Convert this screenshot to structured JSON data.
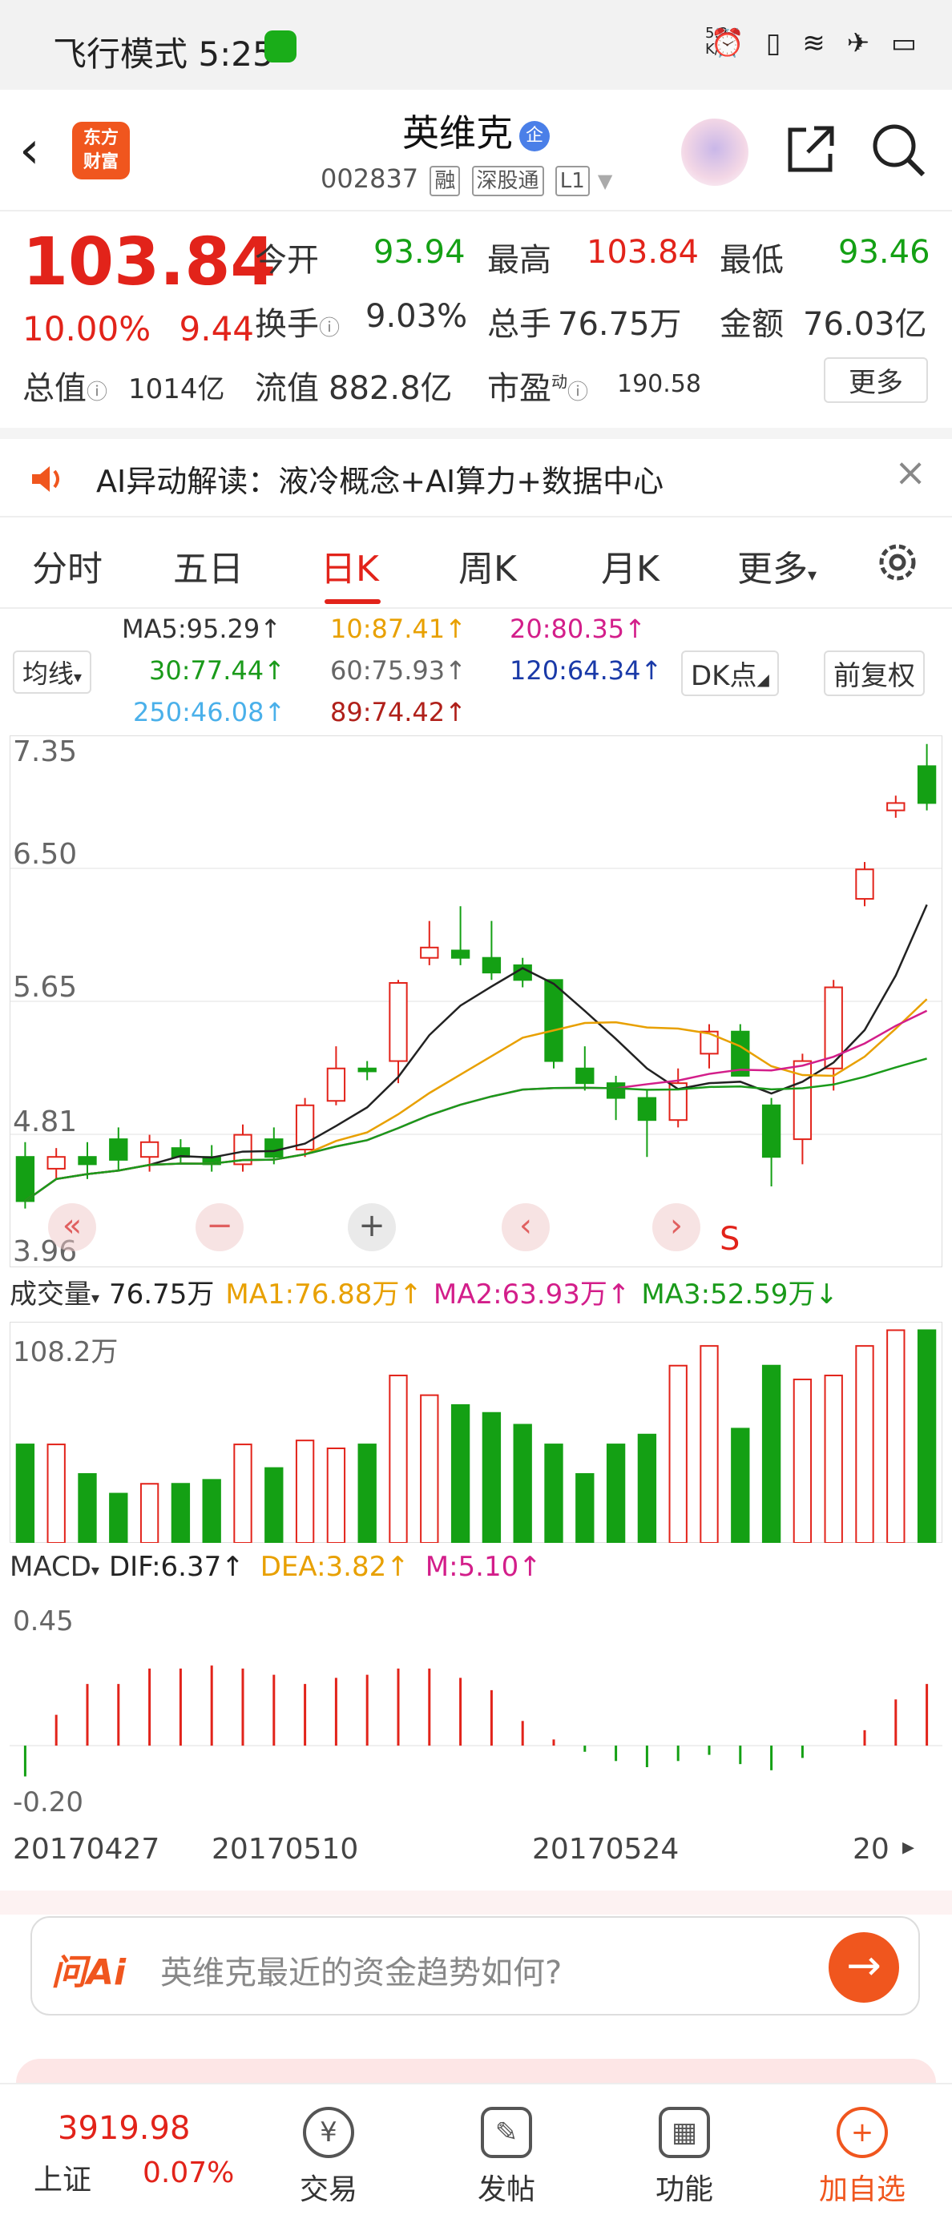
{
  "status_bar": {
    "time": "飞行模式 5:25",
    "net_speed": "5.2\nK/s",
    "icons": "⏰ ▯ ≋ ✈ ▭"
  },
  "header": {
    "back_icon": "chevron-left-icon",
    "logo": "东方\n财富",
    "stock_name": "英维克",
    "badge": "企",
    "code": "002837",
    "tags": [
      "融",
      "深股通",
      "L1"
    ],
    "share_icon": "share-icon",
    "search_icon": "search-icon"
  },
  "quote": {
    "price": "103.84",
    "change_pct": "10.00%",
    "change_amt": "9.44",
    "open_label": "今开",
    "open": "93.94",
    "high_label": "最高",
    "high": "103.84",
    "low_label": "最低",
    "low": "93.46",
    "turnover_label": "换手",
    "turnover": "9.03%",
    "volume_label": "总手",
    "volume": "76.75万",
    "amount_label": "金额",
    "amount": "76.03亿",
    "mktcap_label": "总值",
    "mktcap": "1014亿",
    "float_label": "流值",
    "float": "882.8亿",
    "pe_label": "市盈",
    "pe_sup": "动",
    "pe": "190.58",
    "more_label": "更多"
  },
  "banner": {
    "text": "AI异动解读：液冷概念+AI算力+数据中心"
  },
  "tabs": [
    "分时",
    "五日",
    "日K",
    "周K",
    "月K",
    "更多"
  ],
  "ma_panel": {
    "select_label": "均线",
    "ma5": "MA5:95.29↑",
    "ma10": "10:87.41↑",
    "ma20": "20:80.35↑",
    "ma30": "30:77.44↑",
    "ma60": "60:75.93↑",
    "ma120": "120:64.34↑",
    "ma250": "250:46.08↑",
    "ma89": "89:74.42↑",
    "dk_label": "DK点",
    "fq_label": "前复权"
  },
  "price_axis": [
    "7.35",
    "6.50",
    "5.65",
    "4.81",
    "3.96"
  ],
  "vol_panel": {
    "select_label": "成交量",
    "vol": "76.75万",
    "ma1": "MA1:76.88万↑",
    "ma2": "MA2:63.93万↑",
    "ma3": "MA3:52.59万↓",
    "axis_max": "108.2万"
  },
  "macd_panel": {
    "select_label": "MACD",
    "dif": "DIF:6.37↑",
    "dea": "DEA:3.82↑",
    "m": "M:5.10↑",
    "axis_max": "0.45",
    "axis_min": "-0.20"
  },
  "dates": [
    "20170427",
    "20170510",
    "20170524",
    "20"
  ],
  "chart_nav": {
    "prev": "«",
    "minus": "−",
    "plus": "+",
    "left": "‹",
    "right": "›",
    "s": "S"
  },
  "ai_ask": {
    "logo": "问Ai",
    "placeholder": "英维克最近的资金趋势如何?"
  },
  "bottom_nav": {
    "index_value": "3919.98",
    "index_name": "上证",
    "index_pct": "0.07%",
    "items": [
      "交易",
      "发帖",
      "功能",
      "加自选"
    ]
  },
  "colors": {
    "up": "#e2231a",
    "down": "#14a014",
    "accent": "#f0561e"
  },
  "chart_data": {
    "type": "candlestick",
    "ylim": [
      3.96,
      7.35
    ],
    "candles": [
      [
        4.6,
        4.3,
        4.7,
        4.25
      ],
      [
        4.52,
        4.6,
        4.66,
        4.45
      ],
      [
        4.6,
        4.55,
        4.7,
        4.45
      ],
      [
        4.72,
        4.58,
        4.8,
        4.5
      ],
      [
        4.6,
        4.7,
        4.75,
        4.5
      ],
      [
        4.66,
        4.6,
        4.72,
        4.55
      ],
      [
        4.6,
        4.55,
        4.68,
        4.5
      ],
      [
        4.55,
        4.75,
        4.82,
        4.5
      ],
      [
        4.72,
        4.6,
        4.8,
        4.55
      ],
      [
        4.65,
        4.95,
        5.0,
        4.6
      ],
      [
        4.98,
        5.2,
        5.35,
        4.95
      ],
      [
        5.2,
        5.18,
        5.25,
        5.12
      ],
      [
        5.25,
        5.78,
        5.8,
        5.1
      ],
      [
        5.95,
        6.02,
        6.2,
        5.9
      ],
      [
        6.0,
        5.95,
        6.3,
        5.9
      ],
      [
        5.95,
        5.85,
        6.2,
        5.8
      ],
      [
        5.9,
        5.8,
        5.95,
        5.75
      ],
      [
        5.8,
        5.25,
        5.8,
        5.2
      ],
      [
        5.2,
        5.1,
        5.35,
        5.05
      ],
      [
        5.1,
        5.0,
        5.15,
        4.85
      ],
      [
        5.0,
        4.85,
        5.05,
        4.6
      ],
      [
        4.85,
        5.1,
        5.2,
        4.8
      ],
      [
        5.3,
        5.45,
        5.5,
        5.2
      ],
      [
        5.45,
        5.15,
        5.5,
        5.15
      ],
      [
        4.95,
        4.6,
        5.0,
        4.4
      ],
      [
        4.72,
        5.25,
        5.3,
        4.55
      ],
      [
        5.2,
        5.75,
        5.8,
        5.05
      ],
      [
        6.35,
        6.55,
        6.6,
        6.3
      ],
      [
        6.95,
        7.0,
        7.05,
        6.9
      ],
      [
        7.25,
        7.0,
        7.4,
        6.95
      ]
    ],
    "volume": [
      0.5,
      0.5,
      0.35,
      0.25,
      0.3,
      0.3,
      0.32,
      0.5,
      0.38,
      0.52,
      0.48,
      0.5,
      0.85,
      0.75,
      0.7,
      0.66,
      0.6,
      0.5,
      0.35,
      0.5,
      0.55,
      0.9,
      1.0,
      0.58,
      0.9,
      0.83,
      0.85,
      1.0,
      1.08,
      1.08
    ],
    "macd": [
      -0.1,
      0.1,
      0.2,
      0.2,
      0.25,
      0.25,
      0.26,
      0.25,
      0.23,
      0.2,
      0.22,
      0.23,
      0.25,
      0.25,
      0.22,
      0.18,
      0.08,
      0.02,
      -0.02,
      -0.05,
      -0.07,
      -0.05,
      -0.03,
      -0.06,
      -0.08,
      -0.04,
      0.0,
      0.05,
      0.15,
      0.2
    ]
  }
}
